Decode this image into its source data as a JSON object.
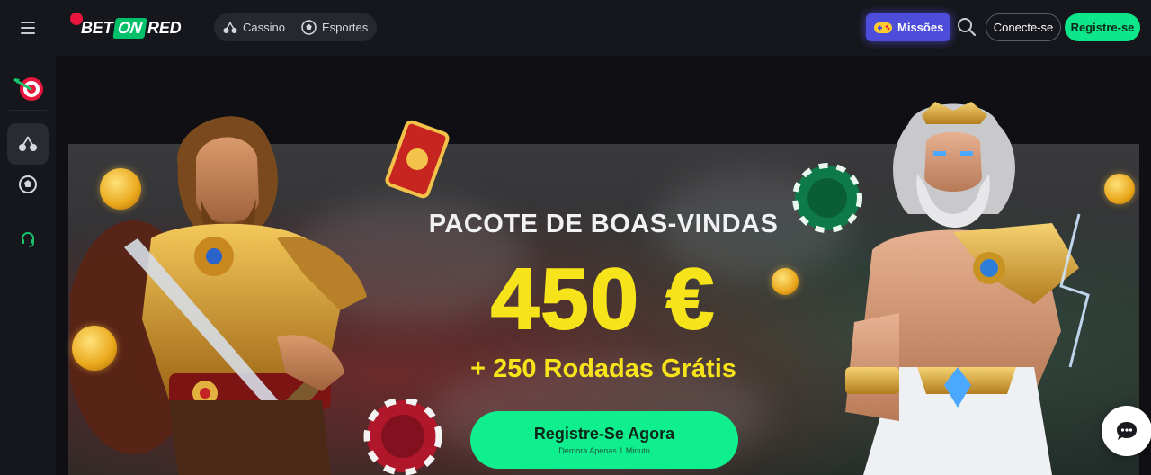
{
  "brand": {
    "logo_bet": "BET",
    "logo_on": "ON",
    "logo_red": "RED"
  },
  "nav": {
    "tabs": [
      {
        "label": "Cassino",
        "icon": "cherry-icon"
      },
      {
        "label": "Esportes",
        "icon": "soccer-ball-icon"
      }
    ]
  },
  "header": {
    "missions_label": "Missões",
    "login_label": "Conecte-se",
    "register_label": "Registre-se"
  },
  "sidebar": {
    "items": [
      {
        "name": "missions-dart-icon",
        "active": false
      },
      {
        "name": "casino-cherry-icon",
        "active": true
      },
      {
        "name": "sports-ball-icon",
        "active": false
      },
      {
        "name": "support-headset-icon",
        "active": false
      }
    ]
  },
  "promo": {
    "title": "PACOTE DE BOAS-VINDAS",
    "amount": "450 €",
    "subtitle": "+ 250 Rodadas Grátis",
    "cta_label": "Registre-Se Agora",
    "cta_sublabel": "Demora Apenas 1 Minuto"
  },
  "colors": {
    "accent_green": "#10ef8e",
    "promo_yellow": "#f6e31a",
    "missions_purple": "#4d4ddc",
    "brand_red": "#e8163d"
  }
}
